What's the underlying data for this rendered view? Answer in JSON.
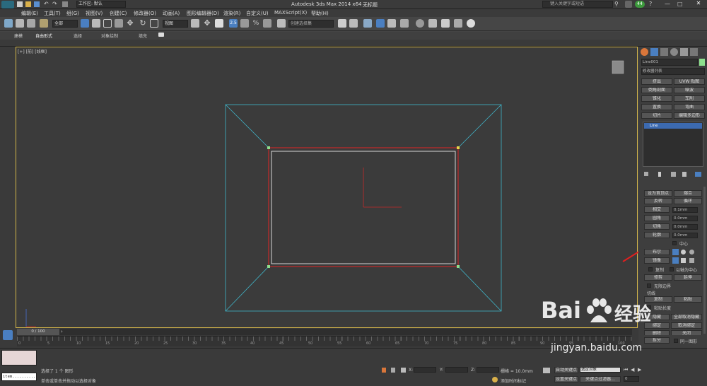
{
  "app": {
    "title": "Autodesk 3ds Max  2014 x64",
    "file": "无标题",
    "workspace": "工作区: 默认",
    "search_placeholder": "键入关键字或短语"
  },
  "menu": [
    "编辑(E)",
    "工具(T)",
    "组(G)",
    "视图(V)",
    "创建(C)",
    "修改器(O)",
    "动画(A)",
    "图形编辑器(D)",
    "渲染(R)",
    "自定义(U)",
    "MAXScript(X)",
    "帮助(H)"
  ],
  "toolbar": {
    "selection_filter": "全部",
    "ref_coord": "视图",
    "named_selection": "创建选择集",
    "snap_label": "2.5",
    "percent_label": "%"
  },
  "ribbon_tabs": [
    "建模",
    "自由形式",
    "选择",
    "对象绘制",
    "填充"
  ],
  "viewport": {
    "label_plus": "[+]",
    "label_view": "[前]",
    "label_shading": "[线框]"
  },
  "cmd": {
    "object_name": "Line001",
    "object_color": "#8ee08e",
    "modifier_list": "修改器列表",
    "buttons": [
      [
        "挤出",
        "UVW 贴图"
      ],
      [
        "倒角剖面",
        "噪波"
      ],
      [
        "锥化",
        "车削"
      ],
      [
        "置换",
        "弯曲"
      ],
      [
        "切片",
        "编辑多边形"
      ]
    ],
    "stack_item": "Line",
    "geom_buttons": [
      [
        "设为首顶点",
        "熔合"
      ],
      [
        "反转",
        "循环"
      ]
    ],
    "params": [
      {
        "label": "相交",
        "value": "0.1mm"
      },
      {
        "label": "圆角",
        "value": "0.0mm"
      },
      {
        "label": "切角",
        "value": "0.0mm"
      },
      {
        "label": "轮廓",
        "value": "0.0mm"
      }
    ],
    "center_label": "中心",
    "boolean_label": "布尔",
    "mirror_label": "镜像",
    "copy_label": "复制",
    "axis_label": "以轴为中心",
    "trim_label": "修剪",
    "extend_label": "延伸",
    "infinite_label": "无限边界",
    "tangent_label": "切线",
    "tan_copy": "复制",
    "tan_paste": "粘贴",
    "paste_length": "粘贴长度",
    "hide_label": "隐藏",
    "unhide_all": "全部取消隐藏",
    "bind_label": "绑定",
    "unbind_label": "取消绑定",
    "delete_label": "删除",
    "close_label": "关闭",
    "split_label": "拆分",
    "same_shape": "同一图形"
  },
  "timeline": {
    "frame": "0 / 100",
    "ticks": [
      "0",
      "5",
      "10",
      "15",
      "20",
      "25",
      "30",
      "35",
      "40",
      "45",
      "50",
      "55",
      "60",
      "65",
      "70",
      "75",
      "80",
      "85",
      "90",
      "95",
      "100"
    ]
  },
  "status": {
    "selected": "选择了 1 个 图形",
    "prompt": "单击或单击并拖动以选择对象",
    "script_input": "item...........?",
    "x_label": "X:",
    "y_label": "Y:",
    "z_label": "Z:",
    "grid": "栅格 = 10.0mm",
    "auto_key": "自动关键点",
    "selected_obj": "选定对象",
    "set_key": "设置关键点",
    "key_filter": "关键点过滤器...",
    "add_time_tag": "添加时间标记",
    "frame_value": "0"
  },
  "watermark": {
    "brand": "Bai",
    "brand2": "经验",
    "url": "jingyan.baidu.com"
  }
}
